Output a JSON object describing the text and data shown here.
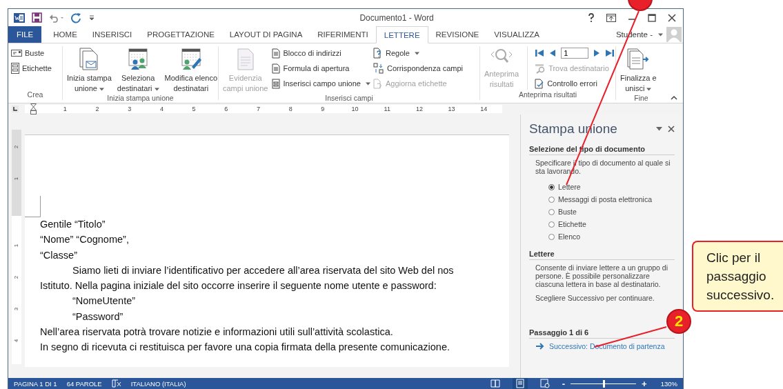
{
  "window": {
    "title": "Documento1 - Word"
  },
  "tabs": [
    {
      "label": "FILE",
      "kind": "file",
      "selected": false
    },
    {
      "label": "HOME",
      "kind": "tab",
      "selected": false
    },
    {
      "label": "INSERISCI",
      "kind": "tab",
      "selected": false
    },
    {
      "label": "PROGETTAZIONE",
      "kind": "tab",
      "selected": false
    },
    {
      "label": "LAYOUT DI PAGINA",
      "kind": "tab",
      "selected": false
    },
    {
      "label": "RIFERIMENTI",
      "kind": "tab",
      "selected": false
    },
    {
      "label": "LETTERE",
      "kind": "tab",
      "selected": true
    },
    {
      "label": "REVISIONE",
      "kind": "tab",
      "selected": false
    },
    {
      "label": "VISUALIZZA",
      "kind": "tab",
      "selected": false
    }
  ],
  "user": {
    "name": "Studente -"
  },
  "ribbon": {
    "groups": [
      {
        "label": "Crea",
        "items": [
          {
            "kind": "stack",
            "items": [
              {
                "label": "Buste",
                "disabled": false,
                "dropdown": false
              },
              {
                "label": "Etichette",
                "disabled": false,
                "dropdown": false
              }
            ]
          }
        ]
      },
      {
        "label": "Inizia stampa unione",
        "items": [
          {
            "kind": "large",
            "label": "Inizia stampa\nunione",
            "disabled": false,
            "dropdown": true
          },
          {
            "kind": "large",
            "label": "Seleziona\ndestinatari",
            "disabled": false,
            "dropdown": true
          },
          {
            "kind": "large",
            "label": "Modifica elenco\ndestinatari",
            "disabled": false,
            "dropdown": false
          }
        ]
      },
      {
        "label": "Inserisci campi",
        "items": [
          {
            "kind": "large",
            "label": "Evidenzia\ncampi unione",
            "disabled": true,
            "dropdown": false
          },
          {
            "kind": "stack",
            "items": [
              {
                "label": "Blocco di indirizzi",
                "disabled": false,
                "dropdown": false
              },
              {
                "label": "Formula di apertura",
                "disabled": false,
                "dropdown": false
              },
              {
                "label": "Inserisci campo unione",
                "disabled": false,
                "dropdown": true
              }
            ]
          },
          {
            "kind": "stack",
            "items": [
              {
                "label": "Regole",
                "disabled": false,
                "dropdown": true
              },
              {
                "label": "Corrispondenza campi",
                "disabled": false,
                "dropdown": false
              },
              {
                "label": "Aggiorna etichette",
                "disabled": true,
                "dropdown": false
              }
            ]
          }
        ]
      },
      {
        "label": "Anteprima risultati",
        "items": [
          {
            "kind": "large",
            "label": "Anteprima\nrisultati",
            "disabled": true,
            "dropdown": false
          },
          {
            "kind": "stack",
            "items": [
              {
                "kind": "nav",
                "value": "1"
              },
              {
                "label": "Trova destinatario",
                "disabled": true,
                "dropdown": false
              },
              {
                "label": "Controllo errori",
                "disabled": false,
                "dropdown": false
              }
            ]
          }
        ]
      },
      {
        "label": "Fine",
        "items": [
          {
            "kind": "large",
            "label": "Finalizza e\nunisci",
            "disabled": false,
            "dropdown": true
          }
        ]
      }
    ]
  },
  "ruler": {
    "marks": [
      "1",
      "2",
      "3",
      "4",
      "5",
      "6",
      "7",
      "8",
      "9",
      "10",
      "11",
      "12",
      "13",
      "14"
    ],
    "vertical_margin_marks": [
      "2",
      "1"
    ],
    "vertical_text_marks": [
      "1",
      "2",
      "3",
      "4"
    ]
  },
  "document": {
    "lines": [
      {
        "text": "Gentile “Titolo”",
        "kind": "plain"
      },
      {
        "text": "“Nome”  “Cognome”,",
        "kind": "plain"
      },
      {
        "text": "“Classe”",
        "kind": "plain"
      },
      {
        "text": "Siamo lieti di inviare l’identificativo per accedere all’area riservata del sito Web del nos",
        "kind": "indent"
      },
      {
        "text": "Istituto. Nella pagina iniziale del sito occorre inserire il seguente nome utente e password:",
        "kind": "plain"
      },
      {
        "text": "“NomeUtente”",
        "kind": "indent"
      },
      {
        "text": "“Password”",
        "kind": "indent"
      },
      {
        "text": "Nell’area riservata potrà trovare notizie e informazioni utili sull’attività scolastica.",
        "kind": "plain"
      },
      {
        "text": "In segno di ricevuta ci restituisca per favore una copia firmata della presente comunicazione.",
        "kind": "plain"
      }
    ]
  },
  "task_pane": {
    "title": "Stampa unione",
    "sections": [
      {
        "heading": "Selezione del tipo di documento",
        "paragraphs": [
          "Specificare il tipo di documento al quale si sta lavorando."
        ],
        "options": [
          {
            "label": "Lettere",
            "selected": true
          },
          {
            "label": "Messaggi di posta elettronica",
            "selected": false
          },
          {
            "label": "Buste",
            "selected": false
          },
          {
            "label": "Etichette",
            "selected": false
          },
          {
            "label": "Elenco",
            "selected": false
          }
        ]
      },
      {
        "heading": "Lettere",
        "paragraphs": [
          "Consente di inviare lettere a un gruppo di persone. È possibile personalizzare ciascuna lettera in base al destinatario.",
          "Scegliere Successivo per continuare."
        ]
      }
    ],
    "step": {
      "heading": "Passaggio 1 di 6",
      "link": "Successivo: Documento di partenza"
    }
  },
  "status_bar": {
    "items": [
      {
        "kind": "text",
        "label": "PAGINA 1 DI 1"
      },
      {
        "kind": "text",
        "label": "64 PAROLE"
      },
      {
        "kind": "proofing"
      },
      {
        "kind": "text",
        "label": "ITALIANO (ITALIA)"
      }
    ],
    "views": [
      {
        "selected": false
      },
      {
        "selected": true
      },
      {
        "selected": false
      }
    ],
    "zoom": {
      "minus": "-",
      "plus": "+",
      "level": 0.5,
      "reading": "130%"
    }
  },
  "annotations": {
    "markers": [
      {
        "kind": "plain"
      },
      {
        "kind": "numbered",
        "label": "2"
      }
    ],
    "callout": {
      "text": "Clic per il passaggio successivo."
    }
  }
}
